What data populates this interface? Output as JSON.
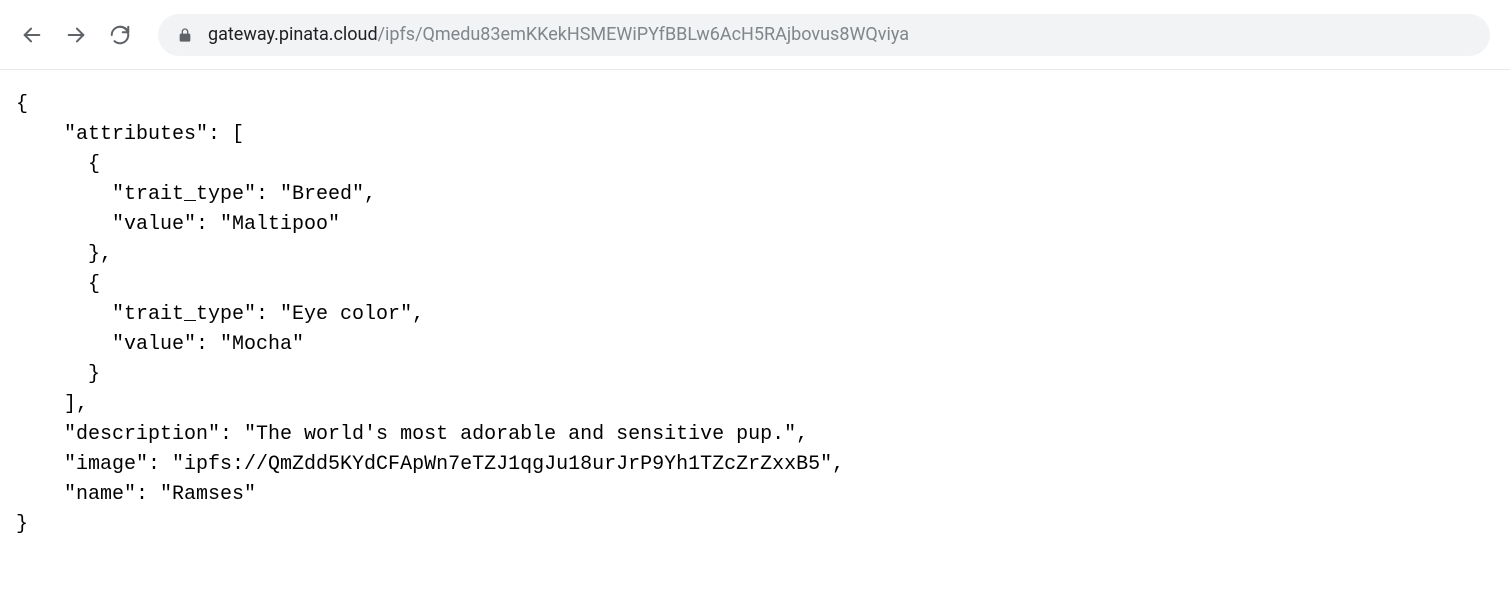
{
  "url": {
    "domain": "gateway.pinata.cloud",
    "path": "/ipfs/Qmedu83emKKekHSMEWiPYfBBLw6AcH5RAjbovus8WQviya"
  },
  "json_content": {
    "attributes": [
      {
        "trait_type": "Breed",
        "value": "Maltipoo"
      },
      {
        "trait_type": "Eye color",
        "value": "Mocha"
      }
    ],
    "description": "The world's most adorable and sensitive pup.",
    "image": "ipfs://QmZdd5KYdCFApWn7eTZJ1qgJu18urJrP9Yh1TZcZrZxxB5",
    "name": "Ramses"
  }
}
